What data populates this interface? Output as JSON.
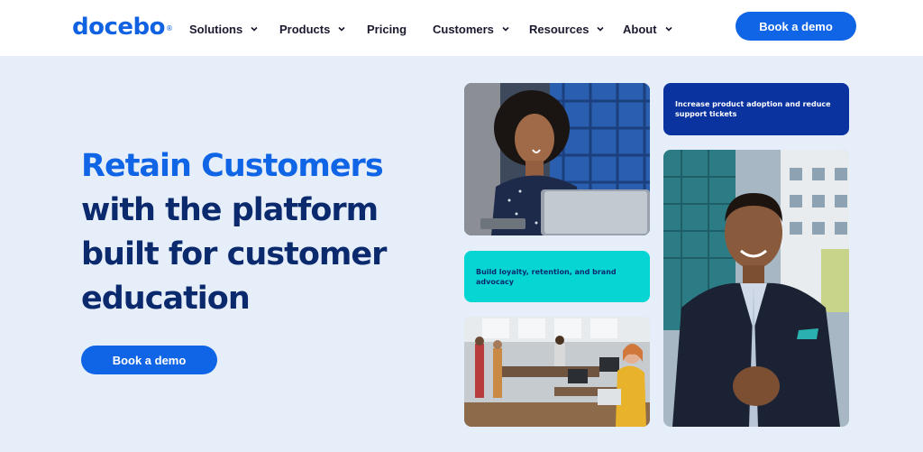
{
  "brand": {
    "name": "docebo",
    "reg": "®",
    "color": "#1162e2"
  },
  "nav": {
    "items": [
      {
        "label": "Solutions",
        "dropdown": true
      },
      {
        "label": "Products",
        "dropdown": true
      },
      {
        "label": "Pricing",
        "dropdown": false
      },
      {
        "label": "Customers",
        "dropdown": true
      },
      {
        "label": "Resources",
        "dropdown": true
      },
      {
        "label": "About",
        "dropdown": true
      }
    ],
    "cta": "Book a demo"
  },
  "hero": {
    "headline_accent": "Retain Customers",
    "headline_rest": "with the platform built for customer education",
    "cta": "Book a demo"
  },
  "cards": {
    "adoption": "Increase product adoption and reduce support tickets",
    "loyalty": "Build loyalty, retention, and brand advocacy"
  },
  "photos": {
    "woman_laptop": "photo-woman-with-laptop",
    "office": "photo-office-team",
    "man_suit": "photo-smiling-man-in-suit"
  },
  "colors": {
    "primary": "#0f65e5",
    "navy": "#0b2a6e",
    "card_blue": "#0a33a0",
    "card_cyan": "#05d6d4",
    "hero_bg": "#e6eefa"
  }
}
